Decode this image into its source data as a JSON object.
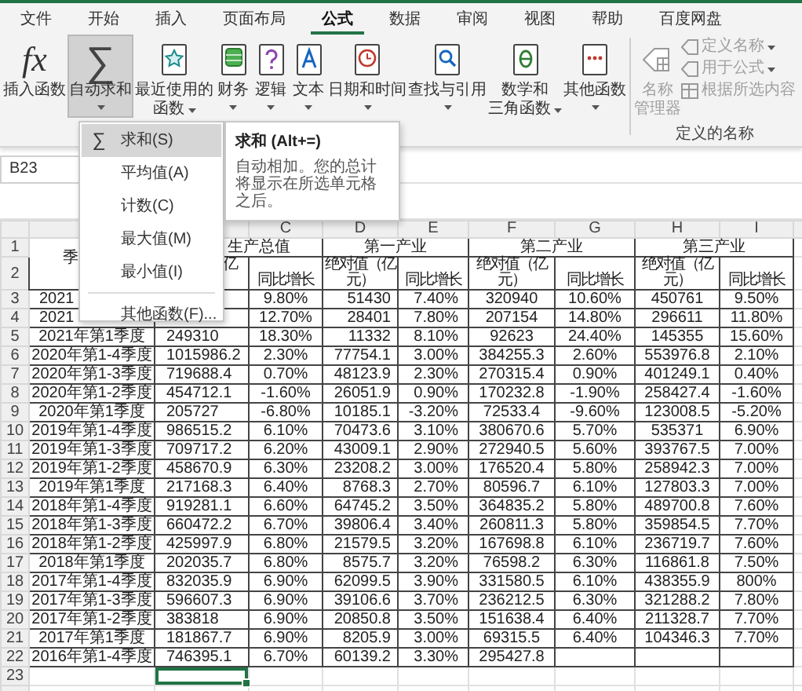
{
  "tabs": [
    {
      "label": "文件",
      "selected": false
    },
    {
      "label": "开始",
      "selected": false
    },
    {
      "label": "插入",
      "selected": false
    },
    {
      "label": "页面布局",
      "selected": false
    },
    {
      "label": "公式",
      "selected": true
    },
    {
      "label": "数据",
      "selected": false
    },
    {
      "label": "审阅",
      "selected": false
    },
    {
      "label": "视图",
      "selected": false
    },
    {
      "label": "帮助",
      "selected": false
    },
    {
      "label": "百度网盘",
      "selected": false
    }
  ],
  "ribbon": {
    "buttons": [
      {
        "lines": [
          "插入函数"
        ],
        "glyph": "fx",
        "dropdown": false,
        "selected": false
      },
      {
        "lines": [
          "自动求和"
        ],
        "glyph": "∑",
        "dropdown": true,
        "selected": true
      },
      {
        "lines": [
          "最近使用的",
          "函数"
        ],
        "dropdown": true,
        "selected": false
      },
      {
        "lines": [
          "财务"
        ],
        "dropdown": true,
        "selected": false
      },
      {
        "lines": [
          "逻辑"
        ],
        "dropdown": true,
        "selected": false
      },
      {
        "lines": [
          "文本"
        ],
        "dropdown": true,
        "selected": false
      },
      {
        "lines": [
          "日期和时间"
        ],
        "dropdown": true,
        "selected": false
      },
      {
        "lines": [
          "查找与引用"
        ],
        "dropdown": true,
        "selected": false
      },
      {
        "lines": [
          "数学和",
          "三角函数"
        ],
        "dropdown": true,
        "selected": false
      },
      {
        "lines": [
          "其他函数"
        ],
        "dropdown": true,
        "selected": false
      }
    ],
    "defined_names": {
      "manager": {
        "lines": [
          "名称",
          "管理器"
        ],
        "disabled": true
      },
      "items": [
        {
          "label": "定义名称",
          "dropdown": true,
          "disabled": true
        },
        {
          "label": "用于公式",
          "dropdown": true,
          "disabled": true
        },
        {
          "label": "根据所选内容",
          "dropdown": false,
          "disabled": true
        }
      ],
      "label": "定义的名称"
    }
  },
  "name_box": "B23",
  "autosum_menu": {
    "items": [
      {
        "kind": "item",
        "glyph": "∑",
        "label": "求和(S)",
        "selected": true
      },
      {
        "kind": "item",
        "label": "平均值(A)",
        "selected": false
      },
      {
        "kind": "item",
        "label": "计数(C)",
        "selected": false
      },
      {
        "kind": "item",
        "label": "最大值(M)",
        "selected": false
      },
      {
        "kind": "item",
        "label": "最小值(I)",
        "selected": false
      },
      {
        "kind": "separator"
      },
      {
        "kind": "item",
        "label": "其他函数(F)...",
        "selected": false
      }
    ]
  },
  "tooltip": {
    "title": "求和 (Alt+=)",
    "text": "自动相加。您的总计将显示在所选单元格之后。"
  },
  "sheet": {
    "columns": [
      "",
      "",
      "C",
      "D",
      "E",
      "F",
      "G",
      "H",
      "I"
    ],
    "title_row": {
      "row": "1",
      "period_heading": "季",
      "groups": [
        "生产总值",
        "第一产业",
        "第二产业",
        "第三产业"
      ]
    },
    "subheading_row": {
      "row": "2",
      "cells": [
        "亿",
        "同比增长",
        "绝对值（亿元）",
        "同比增长",
        "绝对值（亿元）",
        "同比增长",
        "绝对值（亿元）",
        "同比增长"
      ]
    },
    "rows": [
      {
        "row": "3",
        "cells": [
          "2021",
          null,
          "9.80%",
          "51430",
          "7.40%",
          "320940",
          "10.60%",
          "450761",
          "9.50%"
        ]
      },
      {
        "row": "4",
        "cells": [
          "2021",
          null,
          "12.70%",
          "28401",
          "7.80%",
          "207154",
          "14.80%",
          "296611",
          "11.80%"
        ]
      },
      {
        "row": "5",
        "cells": [
          "2021年第1季度",
          "249310",
          "18.30%",
          "11332",
          "8.10%",
          "92623",
          "24.40%",
          "145355",
          "15.60%"
        ]
      },
      {
        "row": "6",
        "cells": [
          "2020年第1-4季度",
          "1015986.2",
          "2.30%",
          "77754.1",
          "3.00%",
          "384255.3",
          "2.60%",
          "553976.8",
          "2.10%"
        ]
      },
      {
        "row": "7",
        "cells": [
          "2020年第1-3季度",
          "719688.4",
          "0.70%",
          "48123.9",
          "2.30%",
          "270315.4",
          "0.90%",
          "401249.1",
          "0.40%"
        ]
      },
      {
        "row": "8",
        "cells": [
          "2020年第1-2季度",
          "454712.1",
          "-1.60%",
          "26051.9",
          "0.90%",
          "170232.8",
          "-1.90%",
          "258427.4",
          "-1.60%"
        ]
      },
      {
        "row": "9",
        "cells": [
          "2020年第1季度",
          "205727",
          "-6.80%",
          "10185.1",
          "-3.20%",
          "72533.4",
          "-9.60%",
          "123008.5",
          "-5.20%"
        ]
      },
      {
        "row": "10",
        "cells": [
          "2019年第1-4季度",
          "986515.2",
          "6.10%",
          "70473.6",
          "3.10%",
          "380670.6",
          "5.70%",
          "535371",
          "6.90%"
        ]
      },
      {
        "row": "11",
        "cells": [
          "2019年第1-3季度",
          "709717.2",
          "6.20%",
          "43009.1",
          "2.90%",
          "272940.5",
          "5.60%",
          "393767.5",
          "7.00%"
        ]
      },
      {
        "row": "12",
        "cells": [
          "2019年第1-2季度",
          "458670.9",
          "6.30%",
          "23208.2",
          "3.00%",
          "176520.4",
          "5.80%",
          "258942.3",
          "7.00%"
        ]
      },
      {
        "row": "13",
        "cells": [
          "2019年第1季度",
          "217168.3",
          "6.40%",
          "8768.3",
          "2.70%",
          "80596.7",
          "6.10%",
          "127803.3",
          "7.00%"
        ]
      },
      {
        "row": "14",
        "cells": [
          "2018年第1-4季度",
          "919281.1",
          "6.60%",
          "64745.2",
          "3.50%",
          "364835.2",
          "5.80%",
          "489700.8",
          "7.60%"
        ]
      },
      {
        "row": "15",
        "cells": [
          "2018年第1-3季度",
          "660472.2",
          "6.70%",
          "39806.4",
          "3.40%",
          "260811.3",
          "5.80%",
          "359854.5",
          "7.70%"
        ]
      },
      {
        "row": "16",
        "cells": [
          "2018年第1-2季度",
          "425997.9",
          "6.80%",
          "21579.5",
          "3.20%",
          "167698.8",
          "6.10%",
          "236719.7",
          "7.60%"
        ]
      },
      {
        "row": "17",
        "cells": [
          "2018年第1季度",
          "202035.7",
          "6.80%",
          "8575.7",
          "3.20%",
          "76598.2",
          "6.30%",
          "116861.8",
          "7.50%"
        ]
      },
      {
        "row": "18",
        "cells": [
          "2017年第1-4季度",
          "832035.9",
          "6.90%",
          "62099.5",
          "3.90%",
          "331580.5",
          "6.10%",
          "438355.9",
          "800%"
        ]
      },
      {
        "row": "19",
        "cells": [
          "2017年第1-3季度",
          "596607.3",
          "6.90%",
          "39106.6",
          "3.70%",
          "236212.5",
          "6.30%",
          "321288.2",
          "7.80%"
        ]
      },
      {
        "row": "20",
        "cells": [
          "2017年第1-2季度",
          "383818",
          "6.90%",
          "20850.8",
          "3.50%",
          "151638.4",
          "6.40%",
          "211328.7",
          "7.70%"
        ]
      },
      {
        "row": "21",
        "cells": [
          "2017年第1季度",
          "181867.7",
          "6.90%",
          "8205.9",
          "3.00%",
          "69315.5",
          "6.40%",
          "104346.3",
          "7.70%"
        ]
      },
      {
        "row": "22",
        "cells": [
          "2016年第1-4季度",
          "746395.1",
          "6.70%",
          "60139.2",
          "3.30%",
          "295427.8",
          null,
          null,
          null
        ]
      },
      {
        "row": "23",
        "cells": [
          null,
          null,
          null,
          null,
          null,
          null,
          null,
          null,
          null
        ],
        "selected_cells": [
          false,
          true,
          false,
          false,
          false,
          false,
          false,
          false,
          false
        ]
      }
    ]
  }
}
